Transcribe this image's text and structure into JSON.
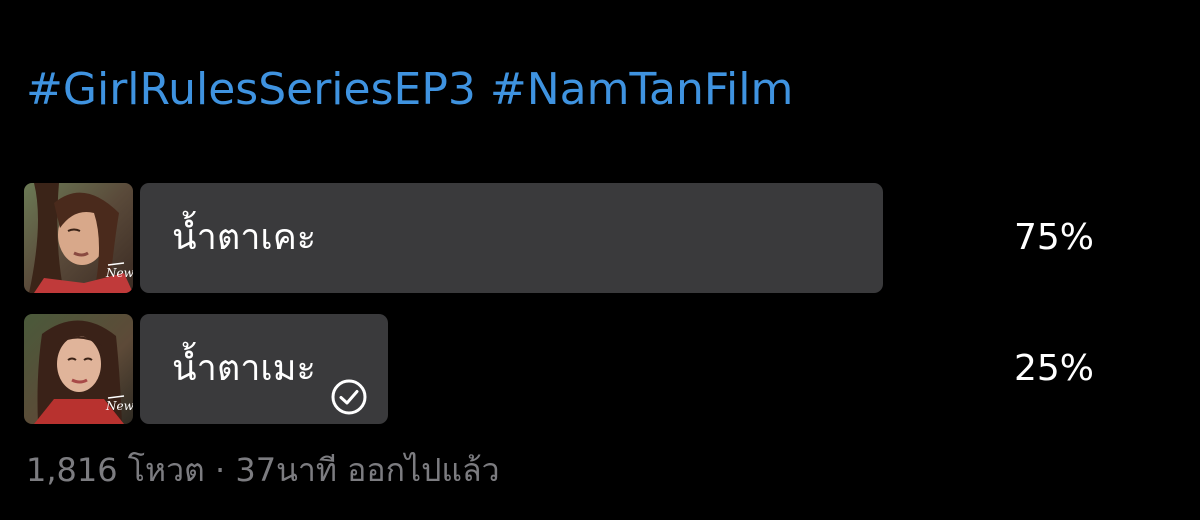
{
  "tweet": {
    "hashtags": [
      "#GirlRulesSeriesEP3",
      "#NamTanFilm"
    ],
    "hashtag_color": "#3f93e0"
  },
  "poll": {
    "options": [
      {
        "label": "น้ำตาเคะ",
        "percent": 75,
        "percent_label": "75%",
        "selected": false,
        "thumbnail": "actress-crying-thumbnail",
        "watermark": "New"
      },
      {
        "label": "น้ำตาเมะ",
        "percent": 25,
        "percent_label": "25%",
        "selected": true,
        "thumbnail": "actress-crying-thumbnail",
        "watermark": "New"
      }
    ],
    "bar_color": "#3a3a3c",
    "check_icon": "check-circle-icon"
  },
  "meta": {
    "votes": "1,816 โหวต",
    "separator": "·",
    "time": "37นาที",
    "status": "ออกไปแล้ว"
  }
}
